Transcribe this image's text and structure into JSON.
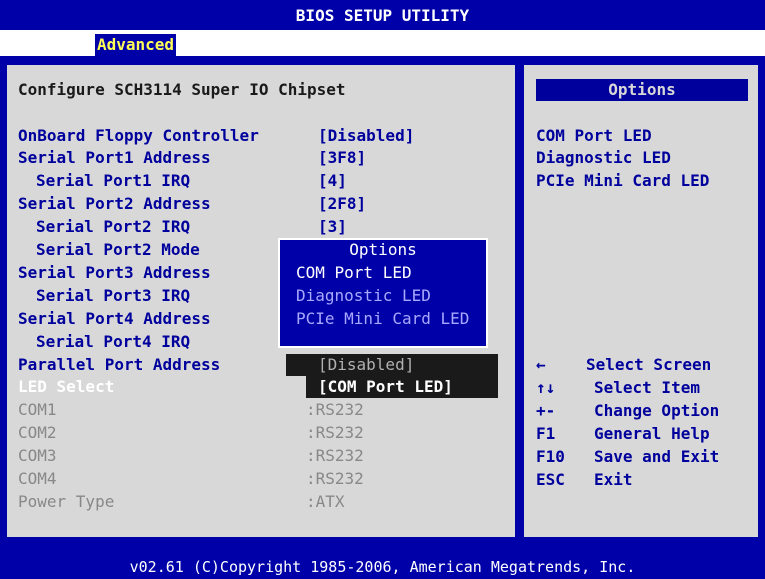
{
  "header": {
    "title": "BIOS SETUP UTILITY",
    "tab": "Advanced"
  },
  "panel": {
    "title": "Configure SCH3114 Super IO Chipset",
    "rows": [
      {
        "label": "OnBoard Floppy Controller",
        "value": "[Disabled]"
      },
      {
        "label": "Serial Port1 Address",
        "value": "[3F8]"
      },
      {
        "label": "  Serial Port1 IRQ",
        "value": "[4]"
      },
      {
        "label": "Serial Port2 Address",
        "value": "[2F8]"
      },
      {
        "label": "  Serial Port2 IRQ",
        "value": "[3]"
      },
      {
        "label": "  Serial Port2 Mode",
        "value": ""
      },
      {
        "label": "Serial Port3 Address",
        "value": ""
      },
      {
        "label": "  Serial Port3 IRQ",
        "value": ""
      },
      {
        "label": "Serial Port4 Address",
        "value": ""
      },
      {
        "label": "  Serial Port4 IRQ",
        "value": ""
      },
      {
        "label": "Parallel Port Address",
        "value": "[Disabled]"
      },
      {
        "label": "LED Select",
        "value": "[COM Port LED]"
      },
      {
        "label": "COM1",
        "value": ":RS232"
      },
      {
        "label": "COM2",
        "value": ":RS232"
      },
      {
        "label": "COM3",
        "value": ":RS232"
      },
      {
        "label": "COM4",
        "value": ":RS232"
      },
      {
        "label": "Power Type",
        "value": ":ATX"
      }
    ]
  },
  "popup": {
    "title": "Options",
    "items": [
      "COM Port LED",
      "Diagnostic LED",
      "PCIe Mini Card LED"
    ]
  },
  "help": {
    "title": "Options",
    "options": [
      "COM Port LED",
      "Diagnostic LED",
      "PCIe Mini Card LED"
    ],
    "keys": [
      {
        "key": "←",
        "desc": "Select Screen"
      },
      {
        "key": "↑↓",
        "desc": "Select Item"
      },
      {
        "key": "+-",
        "desc": "Change Option"
      },
      {
        "key": "F1",
        "desc": "General Help"
      },
      {
        "key": "F10",
        "desc": "Save and Exit"
      },
      {
        "key": "ESC",
        "desc": "Exit"
      }
    ]
  },
  "footer": {
    "copyright": "v02.61 (C)Copyright 1985-2006, American Megatrends, Inc."
  },
  "colors": {
    "bios_blue": "#0000a8",
    "panel_gray": "#d8d8d8",
    "text_blue": "#00009c"
  }
}
